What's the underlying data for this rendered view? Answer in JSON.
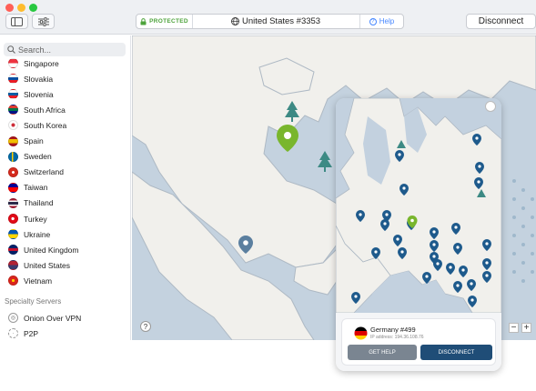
{
  "titlebar": {
    "status": "PROTECTED",
    "server": "United States #3353",
    "help": "Help",
    "disconnect": "Disconnect"
  },
  "sidebar": {
    "search_placeholder": "Search...",
    "countries": [
      {
        "name": "Singapore",
        "flag": "sg"
      },
      {
        "name": "Slovakia",
        "flag": "sk"
      },
      {
        "name": "Slovenia",
        "flag": "si"
      },
      {
        "name": "South Africa",
        "flag": "za"
      },
      {
        "name": "South Korea",
        "flag": "kr"
      },
      {
        "name": "Spain",
        "flag": "es"
      },
      {
        "name": "Sweden",
        "flag": "se"
      },
      {
        "name": "Switzerland",
        "flag": "ch"
      },
      {
        "name": "Taiwan",
        "flag": "tw"
      },
      {
        "name": "Thailand",
        "flag": "th"
      },
      {
        "name": "Turkey",
        "flag": "tr"
      },
      {
        "name": "Ukraine",
        "flag": "ua"
      },
      {
        "name": "United Kingdom",
        "flag": "gb"
      },
      {
        "name": "United States",
        "flag": "us"
      },
      {
        "name": "Vietnam",
        "flag": "vn"
      }
    ],
    "specialty_header": "Specialty Servers",
    "specialty": [
      {
        "name": "Onion Over VPN",
        "icon": "onion-icon"
      },
      {
        "name": "P2P",
        "icon": "p2p-icon"
      }
    ]
  },
  "map": {
    "help_glyph": "?",
    "zoom_out": "−",
    "zoom_in": "+"
  },
  "card": {
    "server": "Germany #499",
    "ip": "IP address: 194.36.108.76",
    "get_help": "GET HELP",
    "disconnect": "DISCONNECT"
  },
  "colors": {
    "accent_green": "#4da33b",
    "pin_green": "#79b62d",
    "pin_blue": "#1e5a8c",
    "map_water": "#c4d2df",
    "map_land": "#f1f0ec",
    "disconnect_blue": "#1f4d77",
    "help_blue": "#4687ff"
  }
}
